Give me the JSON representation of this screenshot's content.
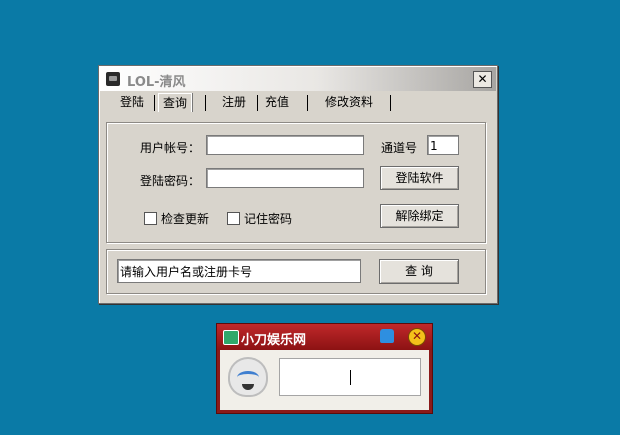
{
  "window": {
    "title": "LOL-清风",
    "close_label": "✕"
  },
  "tabs": [
    "登陆",
    "查询",
    "注册",
    "充值",
    "修改资料"
  ],
  "form": {
    "account_label": "用户帐号：",
    "account_value": "",
    "password_label": "登陆密码：",
    "password_value": "",
    "channel_label": "通道号",
    "channel_value": "1",
    "login_button": "登陆软件",
    "unbind_button": "解除绑定",
    "check_update_label": "检查更新",
    "remember_password_label": "记住密码"
  },
  "query": {
    "input_value": "请输入用户名或注册卡号",
    "button_label": "查  询"
  },
  "mini_window": {
    "title": "小刀娱乐网",
    "close_label": "✕",
    "input_value": ""
  },
  "colors": {
    "desktop": "#0a7aa6",
    "window_bg": "#d8d4cc",
    "mini_title": "#a81e1f"
  }
}
